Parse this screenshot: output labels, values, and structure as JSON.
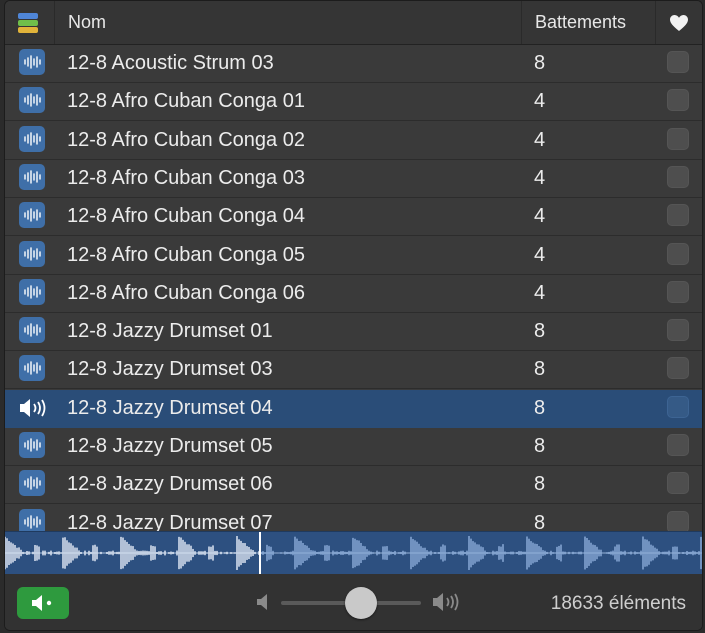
{
  "header": {
    "name_label": "Nom",
    "beats_label": "Battements",
    "favorite_icon": "heart-icon"
  },
  "rows": [
    {
      "name": "12-8 Acoustic Strum 03",
      "beats": "8",
      "selected": false
    },
    {
      "name": "12-8 Afro Cuban Conga 01",
      "beats": "4",
      "selected": false
    },
    {
      "name": "12-8 Afro Cuban Conga 02",
      "beats": "4",
      "selected": false
    },
    {
      "name": "12-8 Afro Cuban Conga 03",
      "beats": "4",
      "selected": false
    },
    {
      "name": "12-8 Afro Cuban Conga 04",
      "beats": "4",
      "selected": false
    },
    {
      "name": "12-8 Afro Cuban Conga 05",
      "beats": "4",
      "selected": false
    },
    {
      "name": "12-8 Afro Cuban Conga 06",
      "beats": "4",
      "selected": false
    },
    {
      "name": "12-8 Jazzy Drumset 01",
      "beats": "8",
      "selected": false
    },
    {
      "name": "12-8 Jazzy Drumset 03",
      "beats": "8",
      "selected": false
    },
    {
      "name": "12-8 Jazzy Drumset 04",
      "beats": "8",
      "selected": true
    },
    {
      "name": "12-8 Jazzy Drumset 05",
      "beats": "8",
      "selected": false
    },
    {
      "name": "12-8 Jazzy Drumset 06",
      "beats": "8",
      "selected": false
    },
    {
      "name": "12-8 Jazzy Drumset 07",
      "beats": "8",
      "selected": false
    }
  ],
  "preview": {
    "playhead_fraction": 0.37
  },
  "footer": {
    "volume_level": 0.57,
    "count_label": "18633 éléments"
  },
  "colors": {
    "selection": "#2a4d78",
    "loop_icon": "#3f6fa8",
    "play_button": "#2e9a3e"
  }
}
